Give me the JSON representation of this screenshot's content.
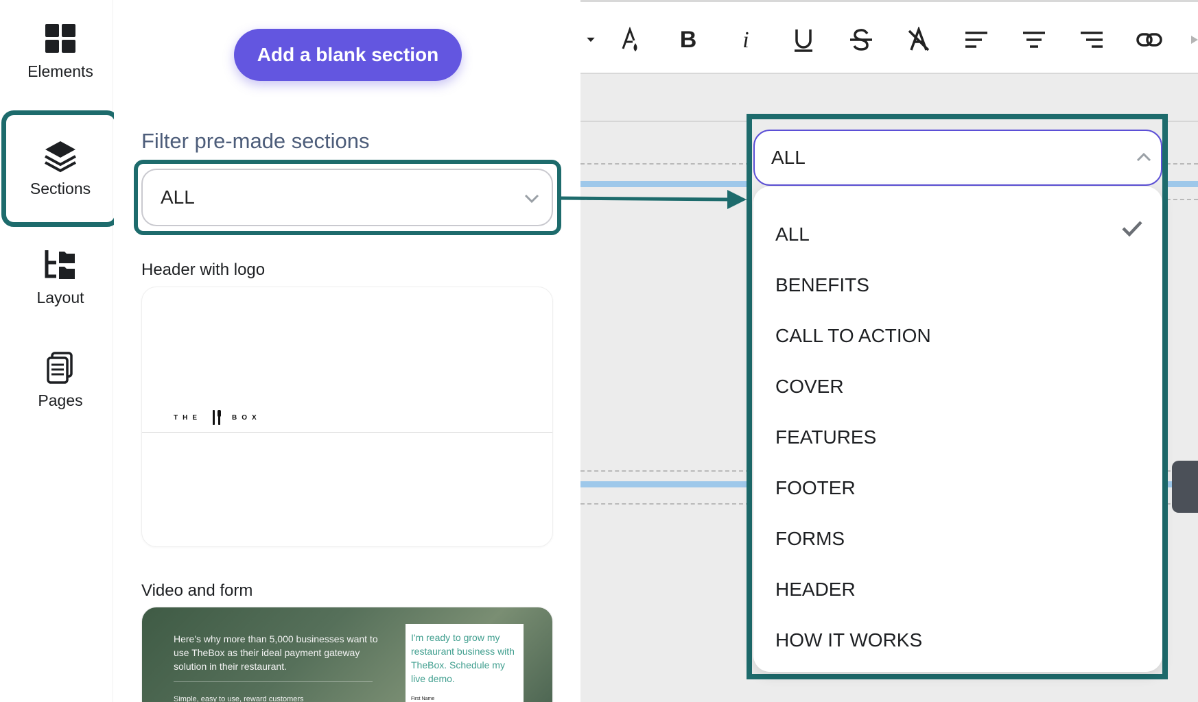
{
  "nav": {
    "items": [
      {
        "label": "Elements",
        "icon": "grid-icon"
      },
      {
        "label": "Sections",
        "icon": "layers-icon",
        "active": true
      },
      {
        "label": "Layout",
        "icon": "layout-folders-icon"
      },
      {
        "label": "Pages",
        "icon": "pages-icon"
      }
    ]
  },
  "panel": {
    "add_button": "Add a blank section",
    "filter_title": "Filter pre-made sections",
    "filter_value": "ALL",
    "sections": [
      {
        "label": "Header with logo",
        "logo_left": "THE",
        "logo_right": "BOX"
      },
      {
        "label": "Video and form",
        "headline": "Here's why more than 5,000 businesses want to use TheBox as their ideal payment gateway solution in their restaurant.",
        "subline": "Simple, easy to use, reward customers",
        "form_text": "I'm ready to grow my restaurant business with TheBox. Schedule my live demo.",
        "form_field": "First Name"
      }
    ]
  },
  "editor": {
    "dropdown": {
      "selected": "ALL",
      "options": [
        "ALL",
        "BENEFITS",
        "CALL TO ACTION",
        "COVER",
        "FEATURES",
        "FOOTER",
        "FORMS",
        "HEADER",
        "HOW IT WORKS"
      ]
    }
  },
  "colors": {
    "accent": "#6356e0",
    "highlight": "#1d6b6c",
    "select_border": "#5b4fd6"
  }
}
